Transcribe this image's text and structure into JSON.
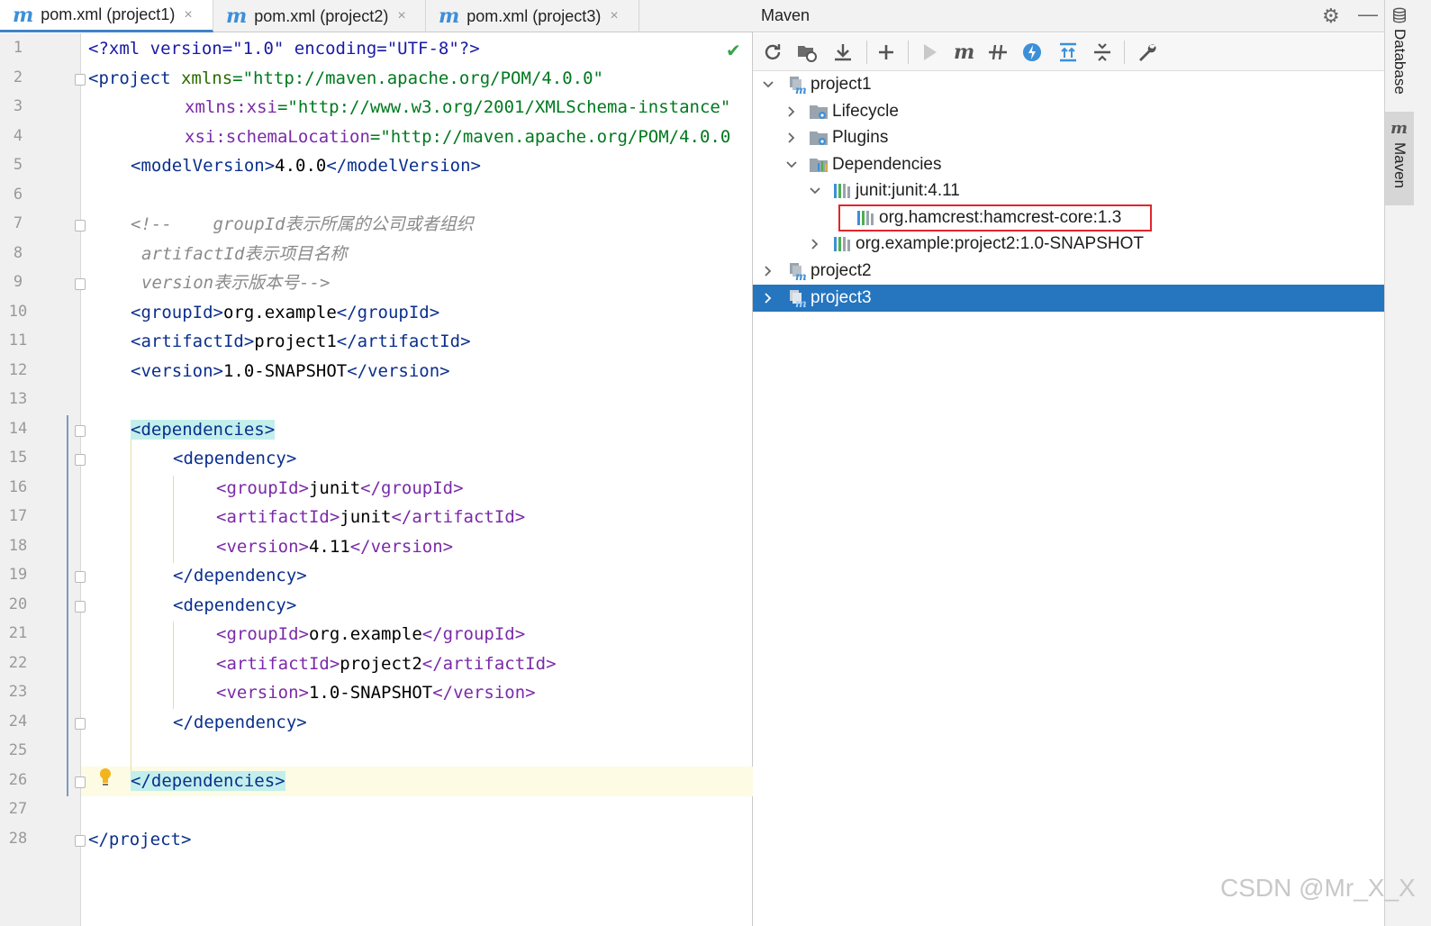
{
  "editor": {
    "tabs": [
      {
        "label": "pom.xml (project1)",
        "active": true
      },
      {
        "label": "pom.xml (project2)",
        "active": false
      },
      {
        "label": "pom.xml (project3)",
        "active": false
      }
    ],
    "tab_icon_glyph": "m",
    "close_glyph": "×",
    "line_numbers": [
      "1",
      "2",
      "3",
      "4",
      "5",
      "6",
      "7",
      "8",
      "9",
      "10",
      "11",
      "12",
      "13",
      "14",
      "15",
      "16",
      "17",
      "18",
      "19",
      "20",
      "21",
      "22",
      "23",
      "24",
      "25",
      "26",
      "27",
      "28"
    ],
    "lines": {
      "l1": "<?xml version=\"1.0\" encoding=\"UTF-8\"?>",
      "l2a": "<project ",
      "l2b": "xmlns",
      "l2c": "=\"http://maven.apache.org/POM/4.0.0\"",
      "l3a": "xmlns:xsi",
      "l3b": "=\"http://www.w3.org/2001/XMLSchema-instance\"",
      "l4a": "xsi:schemaLocation",
      "l4b": "=\"http://maven.apache.org/POM/4.0.0",
      "l5a": "<modelVersion>",
      "l5b": "4.0.0",
      "l5c": "</modelVersion>",
      "l7": "<!--    groupId表示所属的公司或者组织",
      "l8": "artifactId表示项目名称",
      "l9": "version表示版本号-->",
      "l10a": "<groupId>",
      "l10b": "org.example",
      "l10c": "</groupId>",
      "l11a": "<artifactId>",
      "l11b": "project1",
      "l11c": "</artifactId>",
      "l12a": "<version>",
      "l12b": "1.0-SNAPSHOT",
      "l12c": "</version>",
      "l14": "<dependencies>",
      "l15": "<dependency>",
      "l16a": "<groupId>",
      "l16b": "junit",
      "l16c": "</groupId>",
      "l17a": "<artifactId>",
      "l17b": "junit",
      "l17c": "</artifactId>",
      "l18a": "<version>",
      "l18b": "4.11",
      "l18c": "</version>",
      "l19": "</dependency>",
      "l20": "<dependency>",
      "l21a": "<groupId>",
      "l21b": "org.example",
      "l21c": "</groupId>",
      "l22a": "<artifactId>",
      "l22b": "project2",
      "l22c": "</artifactId>",
      "l23a": "<version>",
      "l23b": "1.0-SNAPSHOT",
      "l23c": "</version>",
      "l24": "</dependency>",
      "l26": "</dependencies>",
      "l28": "</project>"
    },
    "check_glyph": "✔"
  },
  "maven": {
    "title": "Maven",
    "gear_glyph": "⚙",
    "minimize_glyph": "—",
    "toolbar": [
      "reload-icon",
      "reimport-folder-icon",
      "download-icon",
      "add-icon",
      "run-icon",
      "execute-goal-icon",
      "toggle-offline-icon",
      "skip-tests-icon",
      "show-dependencies-icon",
      "collapse-all-icon",
      "settings-wrench-icon"
    ],
    "tree": {
      "project1": "project1",
      "lifecycle": "Lifecycle",
      "plugins": "Plugins",
      "dependencies": "Dependencies",
      "junit": "junit:junit:4.11",
      "hamcrest": "org.hamcrest:hamcrest-core:1.3",
      "project2_dep": "org.example:project2:1.0-SNAPSHOT",
      "project2": "project2",
      "project3": "project3"
    },
    "selected_item": "project3",
    "highlight_color": "#e0262c",
    "selection_color": "#2675bf"
  },
  "side_strip": {
    "database": "Database",
    "maven": "Maven"
  },
  "watermark": "CSDN @Mr_X_X"
}
